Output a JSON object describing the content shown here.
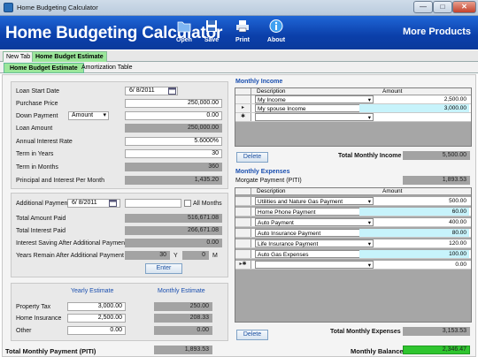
{
  "window": {
    "title": "Home Budgeting Calculator",
    "min": "—",
    "max": "□",
    "close": "✕"
  },
  "header": {
    "title": "Home Budgeting Calculator",
    "more": "More Products",
    "buttons": [
      {
        "label": "Open",
        "icon": "folder-icon"
      },
      {
        "label": "Save",
        "icon": "floppy-disk-icon"
      },
      {
        "label": "Print",
        "icon": "printer-icon"
      },
      {
        "label": "About",
        "icon": "info-icon"
      }
    ]
  },
  "outer_tabs": [
    "New Tab",
    "Home Budget Estimate"
  ],
  "inner_tabs": [
    "Home Budget Estimate",
    "Amortization Table"
  ],
  "loan": {
    "start_label": "Loan Start Date",
    "start_value": "6/ 8/2011",
    "price_label": "Purchase Price",
    "price_value": "250,000.00",
    "down_label": "Down Payment",
    "down_mode": "Amount",
    "down_value": "0.00",
    "amount_label": "Loan Amount",
    "amount_value": "250,000.00",
    "rate_label": "Annual Interest Rate",
    "rate_value": "5.6000%",
    "years_label": "Term in Years",
    "years_value": "30",
    "months_label": "Term in Months",
    "months_value": "360",
    "pi_label": "Principal and Interest Per Month",
    "pi_value": "1,435.20"
  },
  "additional": {
    "label": "Additional Payment",
    "date": "6/ 8/2011",
    "value": "",
    "all_months": "All Months",
    "total_paid_label": "Total Amount Paid",
    "total_paid": "516,671.08",
    "interest_label": "Total Interest Paid",
    "interest": "266,671.08",
    "saving_label": "Interest Saving After Additional Payment",
    "saving": "0.00",
    "remain_label": "Years Remain After Additional Payment",
    "remain_y": "30",
    "y": "Y",
    "remain_m": "0",
    "m": "M",
    "enter": "Enter"
  },
  "estimates": {
    "yearly_header": "Yearly Estimate",
    "monthly_header": "Monthly Estimate",
    "rows": [
      {
        "label": "Property Tax",
        "yearly": "3,000.00",
        "monthly": "250.00"
      },
      {
        "label": "Home Insurance",
        "yearly": "2,500.00",
        "monthly": "208.33"
      },
      {
        "label": "Other",
        "yearly": "0.00",
        "monthly": "0.00"
      }
    ],
    "total_label": "Total Monthly Payment (PITI)",
    "total": "1,893.53"
  },
  "income": {
    "title": "Monthly Income",
    "col_desc": "Description",
    "col_amt": "Amount",
    "rows": [
      {
        "marker": "",
        "desc": "My Income",
        "amt": "2,500.00"
      },
      {
        "marker": "▸",
        "desc": "My spouse Income",
        "amt": "3,000.00"
      },
      {
        "marker": "✱",
        "desc": "",
        "amt": ""
      }
    ],
    "delete": "Delete",
    "total_label": "Total Monthly Income",
    "total": "5,500.00"
  },
  "expenses": {
    "title": "Monthly Expenses",
    "mortgage_label": "Morgate Payment (PITI)",
    "mortgage": "1,893.53",
    "col_desc": "Description",
    "col_amt": "Amount",
    "rows": [
      {
        "marker": "",
        "desc": "Utilities and Nature Gas Payment",
        "amt": "500.00"
      },
      {
        "marker": "",
        "desc": "Home Phone Payment",
        "amt": "60.00"
      },
      {
        "marker": "",
        "desc": "Auto Payment",
        "amt": "400.00"
      },
      {
        "marker": "",
        "desc": "Auto Insurance Payment",
        "amt": "80.00"
      },
      {
        "marker": "",
        "desc": "Life Insurance Payment",
        "amt": "120.00"
      },
      {
        "marker": "",
        "desc": "Auto Gas Expenses",
        "amt": "100.00"
      },
      {
        "marker": "▸✱",
        "desc": "",
        "amt": "0.00"
      }
    ],
    "delete": "Delete",
    "total_label": "Total Monthly Expenses",
    "total": "3,153.53",
    "balance_label": "Monthly Balance",
    "balance": "2,346.47"
  },
  "colors": {
    "header": "#0b3faa",
    "tab_active": "#9be69a",
    "balance": "#2fc52f",
    "readonly": "#a3a3a3",
    "cyan_cell": "#c7f3fb"
  }
}
